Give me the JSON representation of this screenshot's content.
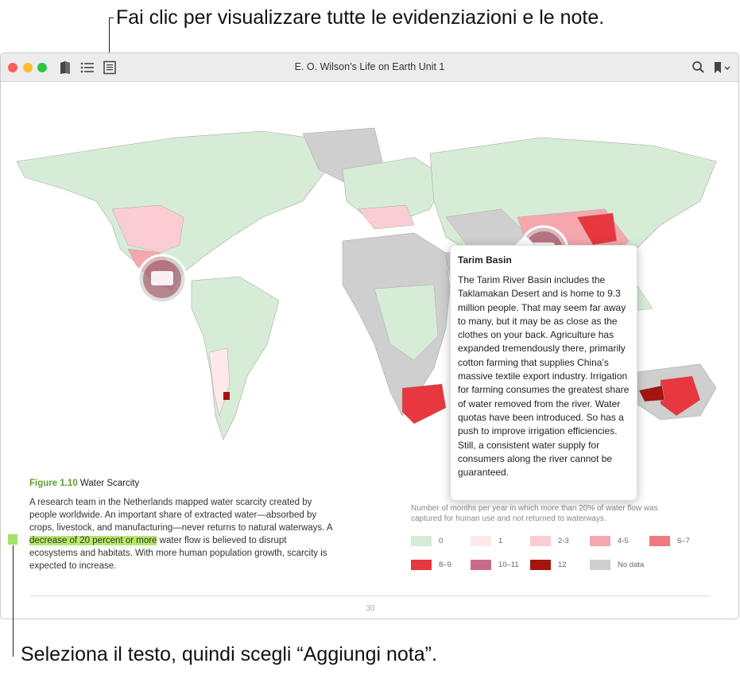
{
  "callouts": {
    "top": "Fai clic per visualizzare tutte le evidenziazioni e le note.",
    "bottom": "Seleziona il testo, quindi scegli “Aggiungi nota”."
  },
  "window": {
    "title": "E. O. Wilson’s Life on Earth Unit 1",
    "icons": [
      "library-icon",
      "table-of-contents-icon",
      "notes-icon",
      "search-icon",
      "bookmark-icon"
    ]
  },
  "popover": {
    "title": "Tarim Basin",
    "body": "The Tarim River Basin includes the Taklamakan Desert and is home to 9.3 million people. That may seem far away to many, but it may be as close as the clothes on your back. Agriculture has expanded tremendously there, primarily cotton farming that supplies China’s massive textile export industry. Irrigation for farming consumes the greatest share of water removed from the river. Water quotas have been introduced. So has a push to improve irrigation efficiencies. Still, a consistent water supply for consumers along the river cannot be guaranteed."
  },
  "figure": {
    "number": "Figure 1.10",
    "title": "Water Scarcity",
    "caption_before": "A research team in the Netherlands mapped water scarcity created by people worldwide. An important share of extracted water—absorbed by crops, livestock, and manufacturing—never returns to natural waterways. A ",
    "caption_highlight": "decrease of 20 percent or more",
    "caption_after": " water flow is believed to disrupt ecosystems and habitats. With more human population growth, scarcity is expected to increase."
  },
  "legend": {
    "description": "Number of months per year in which more than 20% of water flow was captured for human use and not returned to waterways.",
    "items": [
      {
        "label": "0",
        "color": "#d6ecd6"
      },
      {
        "label": "1",
        "color": "#fde8ea"
      },
      {
        "label": "2-3",
        "color": "#f9cdd2"
      },
      {
        "label": "4-5",
        "color": "#f6a7ad"
      },
      {
        "label": "6–7",
        "color": "#f07a80"
      },
      {
        "label": "8–9",
        "color": "#e8373f"
      },
      {
        "label": "10–11",
        "color": "#c96a8e"
      },
      {
        "label": "12",
        "color": "#a5140f"
      },
      {
        "label": "No data",
        "color": "#cfcfcf"
      }
    ]
  },
  "page_number": "30",
  "colors": {
    "highlight": "#b7e86a",
    "figure_label": "#5aa02c",
    "note_marker": "#a6e06b"
  }
}
